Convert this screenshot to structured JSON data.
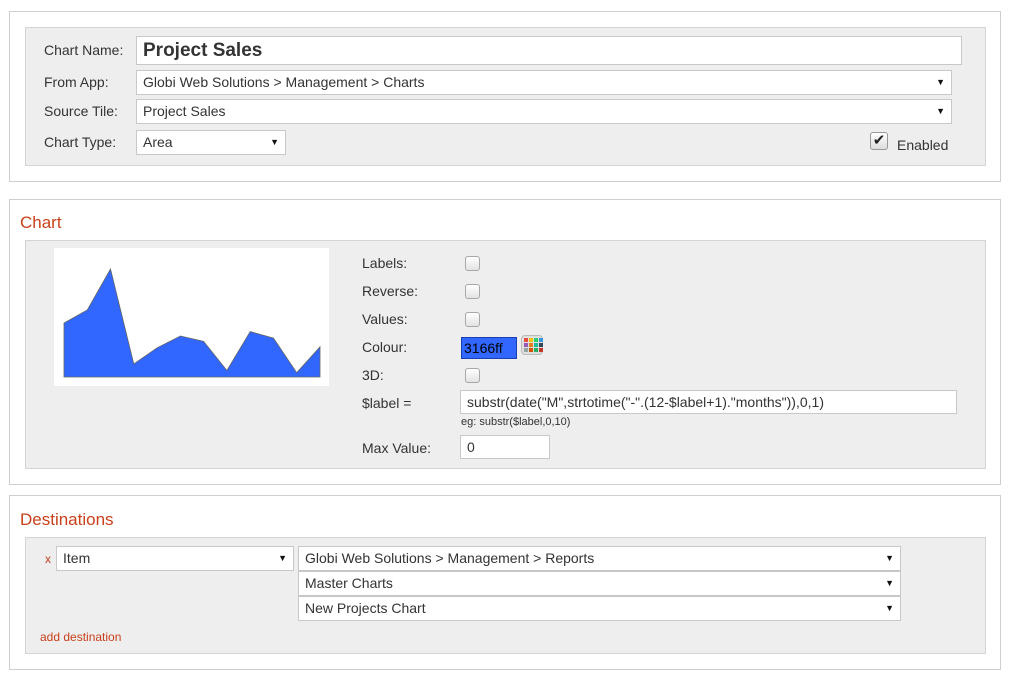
{
  "settings": {
    "chart_name_label": "Chart Name:",
    "chart_name_value": "Project Sales",
    "from_app_label": "From App:",
    "from_app_value": "Globi Web Solutions > Management > Charts",
    "source_tile_label": "Source Tile:",
    "source_tile_value": "Project Sales",
    "chart_type_label": "Chart Type:",
    "chart_type_value": "Area",
    "enabled_label": "Enabled",
    "enabled": true
  },
  "chart_section": {
    "title": "Chart",
    "labels_label": "Labels:",
    "reverse_label": "Reverse:",
    "values_label": "Values:",
    "colour_label": "Colour:",
    "colour_value": "3166ff",
    "threed_label": "3D:",
    "label_expr_label": "$label =",
    "label_expr_value": "substr(date(\"M\",strtotime(\"-\".(12-$label+1).\"months\")),0,1)",
    "label_hint": "eg: substr($label,0,10)",
    "max_value_label": "Max Value:",
    "max_value": "0"
  },
  "chart_data": {
    "type": "area",
    "values": [
      50,
      62,
      100,
      12,
      27,
      38,
      33,
      6,
      42,
      36,
      4,
      28
    ],
    "color": "#3166ff",
    "ylim": [
      0,
      100
    ]
  },
  "destinations": {
    "title": "Destinations",
    "remove_label": "x",
    "item_type": "Item",
    "target_app": "Globi Web Solutions > Management > Reports",
    "target_folder": "Master Charts",
    "target_chart": "New Projects Chart",
    "add_label": "add destination"
  },
  "colors": {
    "accent": "#c9401a",
    "chart_fill": "#3166ff",
    "panel_bg": "#eeeeee"
  }
}
